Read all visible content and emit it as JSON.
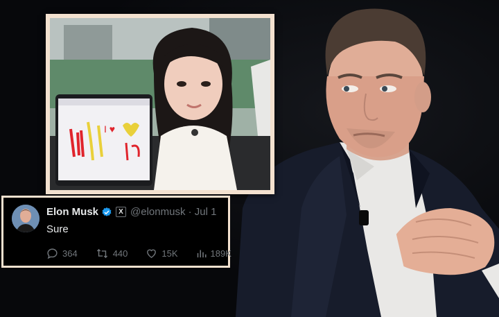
{
  "tweet": {
    "name": "Elon Musk",
    "x_badge": "X",
    "handle_date": "@elonmusk · Jul 1",
    "text": "Sure",
    "replies": "364",
    "reposts": "440",
    "likes": "15K",
    "views": "189K"
  },
  "photo": {
    "screen_doodle_text": "I ♥"
  },
  "colors": {
    "frame": "#f3e1cf",
    "verified": "#1d9bf0",
    "tweet_bg": "#000000",
    "muted_text": "#71767b"
  }
}
